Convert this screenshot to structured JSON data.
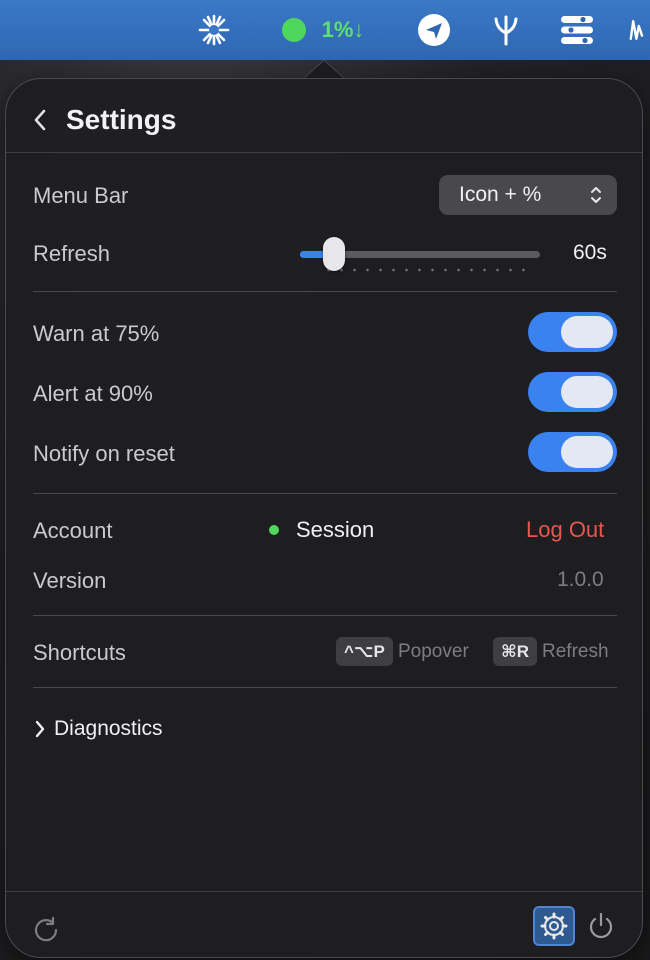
{
  "menubar": {
    "status_text": "1%↓",
    "icons": [
      "asterisk-icon",
      "status-dot-icon",
      "paper-plane-icon",
      "branch-icon",
      "toggles-icon",
      "waveform-icon"
    ],
    "accent_color": "#3a78c6"
  },
  "header": {
    "title": "Settings"
  },
  "menu_bar_setting": {
    "label": "Menu Bar",
    "value": "Icon + %"
  },
  "refresh_setting": {
    "label": "Refresh",
    "value": "60s",
    "slider_level": 0.05
  },
  "toggles": [
    {
      "label": "Warn at 75%",
      "on": true
    },
    {
      "label": "Alert at 90%",
      "on": true
    },
    {
      "label": "Notify on reset",
      "on": true
    }
  ],
  "account": {
    "label": "Account",
    "status": "Session",
    "status_color": "#4fd65c",
    "logout_label": "Log Out"
  },
  "version": {
    "label": "Version",
    "value": "1.0.0"
  },
  "shortcuts": {
    "label": "Shortcuts",
    "items": [
      {
        "keys": "^⌥P",
        "action": "Popover"
      },
      {
        "keys": "⌘R",
        "action": "Refresh"
      }
    ]
  },
  "diagnostics": {
    "label": "Diagnostics"
  },
  "footer": {
    "icons": [
      "refresh-icon",
      "gear-icon",
      "power-icon"
    ]
  }
}
